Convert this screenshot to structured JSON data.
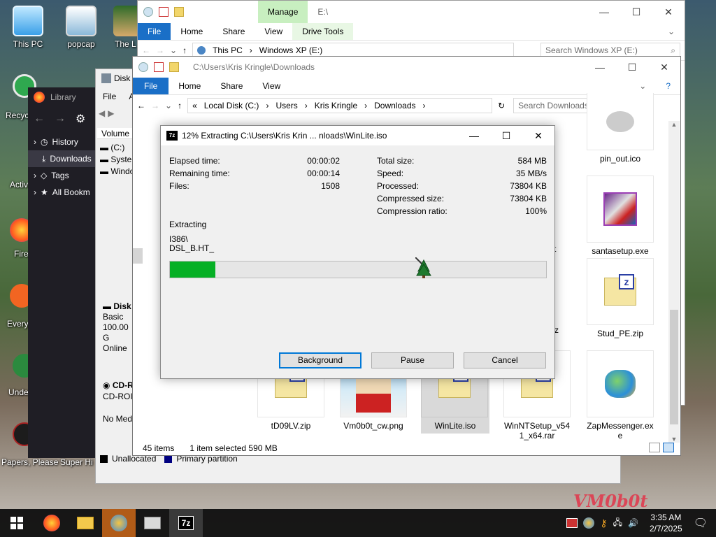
{
  "desktop": {
    "icons": [
      {
        "label": "This PC"
      },
      {
        "label": "popcap"
      },
      {
        "label": "The L"
      },
      {
        "label": "Recyc"
      },
      {
        "label": "Activ"
      },
      {
        "label": "Fire"
      },
      {
        "label": "Every"
      },
      {
        "label": "Unde"
      },
      {
        "label": "Papers, Please"
      },
      {
        "label": "Super Hi"
      }
    ],
    "watermark": "VM0b0t"
  },
  "explorer_back": {
    "ribbon_context": "Manage",
    "path_title": "E:\\",
    "tabs": [
      "File",
      "Home",
      "Share",
      "View",
      "Drive Tools"
    ],
    "address": {
      "root": "This PC",
      "drive": "Windows XP (E:)"
    },
    "search_placeholder": "Search Windows XP (E:)"
  },
  "library": {
    "title": "Library",
    "items": [
      "History",
      "Downloads",
      "Tags",
      "All Bookm"
    ]
  },
  "disk_mgmt": {
    "title": "Disk",
    "menu_file": "File",
    "menu_a": "A",
    "column": "Volume",
    "volumes": [
      "(C:)",
      "Syster",
      "Windo"
    ],
    "disk_label": "Disk",
    "disk_type": "Basic",
    "disk_size": "100.00 G",
    "disk_status": "Online",
    "cd_label": "CD-R",
    "cd_type": "CD-ROI",
    "cd_status": "No Med",
    "legend_unallocated": "Unallocated",
    "legend_primary": "Primary partition"
  },
  "explorer_front": {
    "title_path": "C:\\Users\\Kris Kringle\\Downloads",
    "tabs": [
      "File",
      "Home",
      "Share",
      "View"
    ],
    "breadcrumb": [
      "Local Disk (C:)",
      "Users",
      "Kris Kringle",
      "Downloads"
    ],
    "breadcrumb_prefix": "«",
    "search_placeholder": "Search Downloads",
    "files_right": [
      "pin_out.ico",
      "santasetup.exe",
      "Stud_PE.zip",
      "ZapMessenger.exe"
    ],
    "files_bottom": [
      "tD09LV.zip",
      "Vm0b0t_cw.png",
      "WinLite.iso",
      "WinNTSetup_v541_x64.rar"
    ],
    "partial_labels": [
      "t",
      "z"
    ],
    "status_items": "45 items",
    "status_selected": "1 item selected  590 MB"
  },
  "dialog": {
    "title": "12% Extracting C:\\Users\\Kris Krin ... nloads\\WinLite.iso",
    "left": [
      {
        "label": "Elapsed time:",
        "value": "00:00:02"
      },
      {
        "label": "Remaining time:",
        "value": "00:00:14"
      },
      {
        "label": "Files:",
        "value": "1508"
      }
    ],
    "right": [
      {
        "label": "Total size:",
        "value": "584 MB"
      },
      {
        "label": "Speed:",
        "value": "35 MB/s"
      },
      {
        "label": "Processed:",
        "value": "73804 KB"
      },
      {
        "label": "Compressed size:",
        "value": "73804 KB"
      },
      {
        "label": "Compression ratio:",
        "value": "100%"
      }
    ],
    "action": "Extracting",
    "current_dir": "I386\\",
    "current_file": "DSL_B.HT_",
    "progress": 0.12,
    "buttons": {
      "background": "Background",
      "pause": "Pause",
      "cancel": "Cancel"
    }
  },
  "taskbar": {
    "time": "3:35 AM",
    "date": "2/7/2025",
    "sevenzip_label": "7z"
  },
  "colors": {
    "accent": "#1a6fc7",
    "progress": "#06b025",
    "ribbon_context": "#c8efc0"
  }
}
